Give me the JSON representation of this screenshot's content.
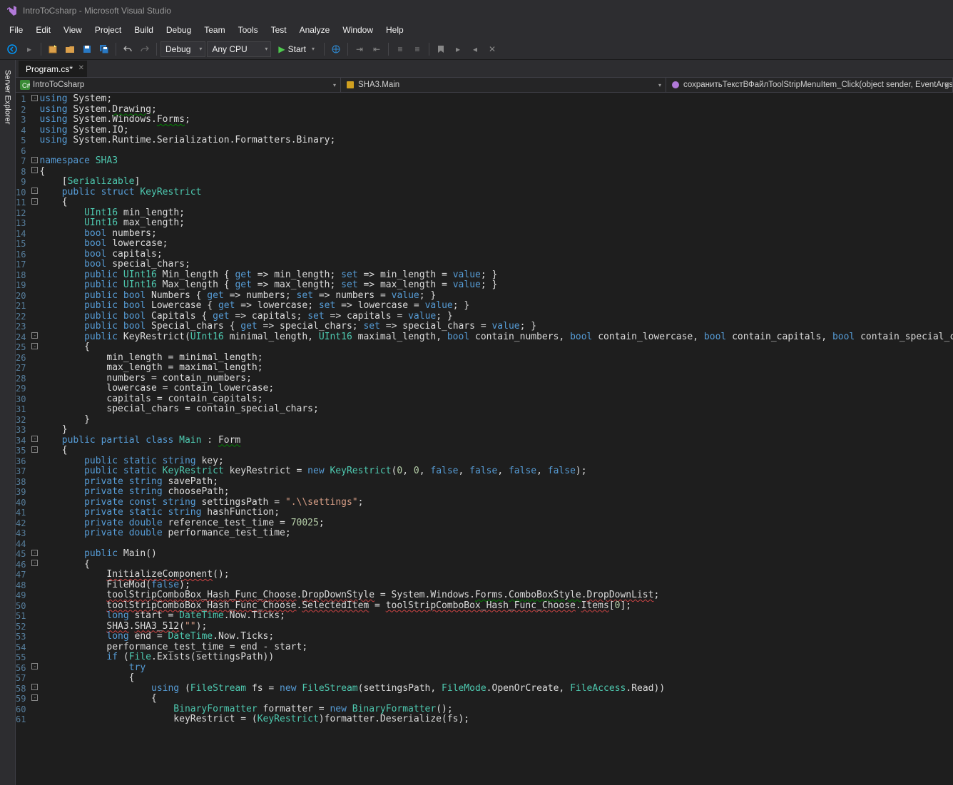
{
  "window": {
    "title": "IntroToCsharp - Microsoft Visual Studio"
  },
  "menu": {
    "items": [
      "File",
      "Edit",
      "View",
      "Project",
      "Build",
      "Debug",
      "Team",
      "Tools",
      "Test",
      "Analyze",
      "Window",
      "Help"
    ]
  },
  "toolbar": {
    "config": "Debug",
    "platform": "Any CPU",
    "start": "Start"
  },
  "side": {
    "server_explorer": "Server Explorer"
  },
  "tabs": {
    "active": "Program.cs*"
  },
  "nav": {
    "project": "IntroToCsharp",
    "type": "SHA3.Main",
    "member": "сохранитьТекстВФайлToolStripMenuItem_Click(object sender, EventArgs e)"
  },
  "code": {
    "first_line": 1,
    "last_line": 61
  }
}
